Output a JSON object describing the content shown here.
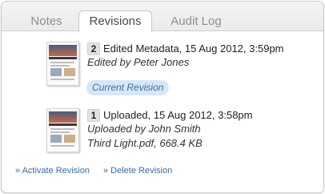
{
  "tabs": {
    "notes": "Notes",
    "revisions": "Revisions",
    "audit_log": "Audit Log"
  },
  "revisions": [
    {
      "number": "2",
      "title": "Edited Metadata, 15 Aug 2012, 3:59pm",
      "editor": "Edited by Peter Jones",
      "badge": "Current Revision"
    },
    {
      "number": "1",
      "title": "Uploaded, 15 Aug 2012, 3:58pm",
      "editor": "Uploaded by John Smith",
      "file": "Third Light.pdf, 668.4 KB"
    }
  ],
  "actions": {
    "activate": "» Activate Revision",
    "delete": "» Delete Revision"
  },
  "colors": {
    "link": "#3a6ea5",
    "badge_bg": "#d6e7f6",
    "badge_text": "#3a6f9c"
  }
}
